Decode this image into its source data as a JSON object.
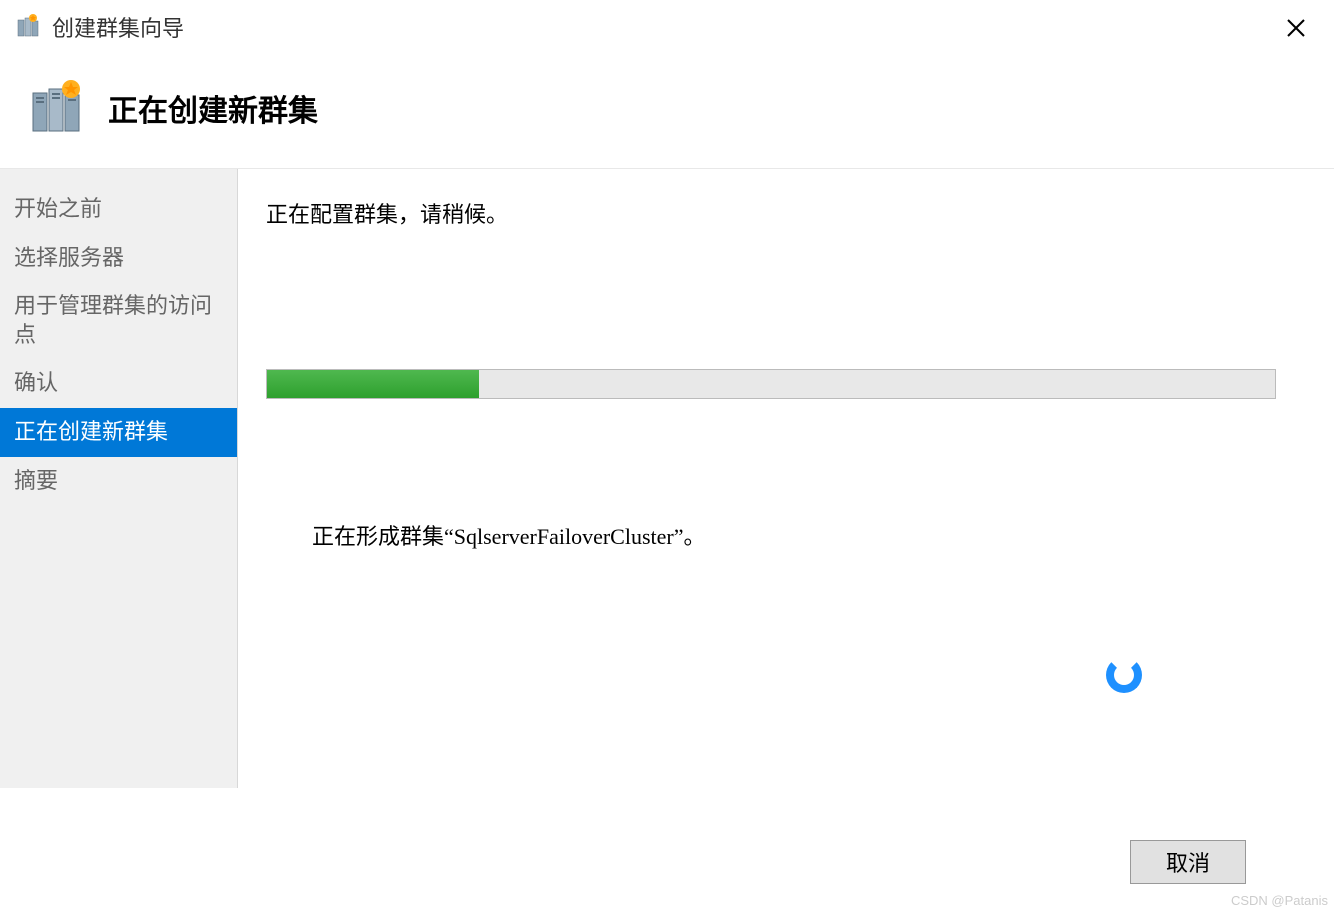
{
  "window": {
    "title": "创建群集向导"
  },
  "header": {
    "title": "正在创建新群集"
  },
  "sidebar": {
    "items": [
      {
        "label": "开始之前",
        "selected": false
      },
      {
        "label": "选择服务器",
        "selected": false
      },
      {
        "label": "用于管理群集的访问点",
        "selected": false
      },
      {
        "label": "确认",
        "selected": false
      },
      {
        "label": "正在创建新群集",
        "selected": true
      },
      {
        "label": "摘要",
        "selected": false
      }
    ]
  },
  "main": {
    "status_text": "正在配置群集，请稍候。",
    "progress_percent": 21,
    "detail_text": "正在形成群集“SqlserverFailoverCluster”。"
  },
  "footer": {
    "cancel_label": "取消"
  },
  "watermark": "CSDN @Patanis"
}
